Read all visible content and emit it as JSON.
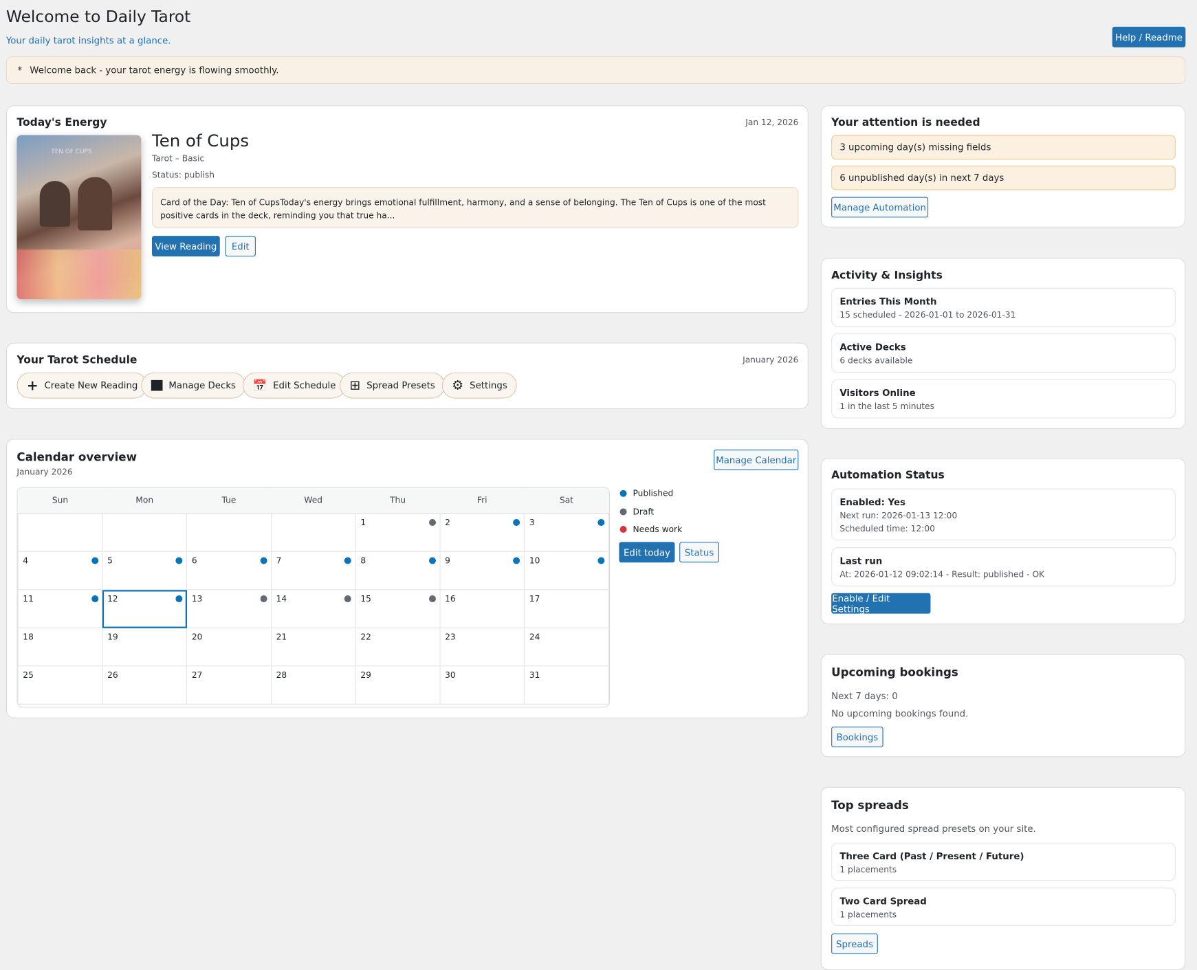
{
  "header": {
    "title": "Welcome to Daily Tarot",
    "subtitle": "Your daily tarot insights at a glance.",
    "help_label": "Help / Readme"
  },
  "notice": {
    "bullet": "*",
    "text": "Welcome back - your tarot energy is flowing smoothly."
  },
  "today": {
    "heading": "Today's Energy",
    "date": "Jan 12, 2026",
    "card_name": "Ten of Cups",
    "card_image_text": "TEN OF CUPS",
    "deck": "Tarot – Basic",
    "status": "Status: publish",
    "excerpt": "Card of the Day: Ten of CupsToday's energy brings emotional fulfillment, harmony, and a sense of belonging. The Ten of Cups is one of the most positive cards in the deck, reminding you that true ha...",
    "view_label": "View Reading",
    "edit_label": "Edit"
  },
  "schedule": {
    "heading": "Your Tarot Schedule",
    "month": "January 2026",
    "actions": [
      {
        "label": "Create New Reading",
        "icon": "plus-icon"
      },
      {
        "label": "Manage Decks",
        "icon": "box-icon"
      },
      {
        "label": "Edit Schedule",
        "icon": "calendar-icon"
      },
      {
        "label": "Spread Presets",
        "icon": "grid-icon"
      },
      {
        "label": "Settings",
        "icon": "gear-icon"
      }
    ]
  },
  "calendar": {
    "heading": "Calendar overview",
    "month": "January 2026",
    "manage_label": "Manage Calendar",
    "weekdays": [
      "Sun",
      "Mon",
      "Tue",
      "Wed",
      "Thu",
      "Fri",
      "Sat"
    ],
    "weeks": [
      [
        null,
        null,
        null,
        null,
        {
          "d": "1",
          "s": "draft"
        },
        {
          "d": "2",
          "s": "published"
        },
        {
          "d": "3",
          "s": "published"
        }
      ],
      [
        {
          "d": "4",
          "s": "published"
        },
        {
          "d": "5",
          "s": "published"
        },
        {
          "d": "6",
          "s": "published"
        },
        {
          "d": "7",
          "s": "published"
        },
        {
          "d": "8",
          "s": "published"
        },
        {
          "d": "9",
          "s": "published"
        },
        {
          "d": "10",
          "s": "published"
        }
      ],
      [
        {
          "d": "11",
          "s": "published"
        },
        {
          "d": "12",
          "s": "published",
          "today": true
        },
        {
          "d": "13",
          "s": "draft"
        },
        {
          "d": "14",
          "s": "draft"
        },
        {
          "d": "15",
          "s": "draft"
        },
        {
          "d": "16"
        },
        {
          "d": "17"
        }
      ],
      [
        {
          "d": "18"
        },
        {
          "d": "19"
        },
        {
          "d": "20"
        },
        {
          "d": "21"
        },
        {
          "d": "22"
        },
        {
          "d": "23"
        },
        {
          "d": "24"
        }
      ],
      [
        {
          "d": "25"
        },
        {
          "d": "26"
        },
        {
          "d": "27"
        },
        {
          "d": "28"
        },
        {
          "d": "29"
        },
        {
          "d": "30"
        },
        {
          "d": "31"
        }
      ]
    ],
    "legend": [
      {
        "label": "Published",
        "color": "#0a73b7"
      },
      {
        "label": "Draft",
        "color": "#646970"
      },
      {
        "label": "Needs work",
        "color": "#d63638"
      }
    ],
    "edit_today_label": "Edit today",
    "status_label": "Status"
  },
  "attention": {
    "heading": "Your attention is needed",
    "items": [
      "3 upcoming day(s) missing fields",
      "6 unpublished day(s) in next 7 days"
    ],
    "button": "Manage Automation"
  },
  "activity": {
    "heading": "Activity & Insights",
    "items": [
      {
        "title": "Entries This Month",
        "detail": "15 scheduled - 2026-01-01 to 2026-01-31"
      },
      {
        "title": "Active Decks",
        "detail": "6 decks available"
      },
      {
        "title": "Visitors Online",
        "detail": "1 in the last 5 minutes"
      }
    ]
  },
  "automation": {
    "heading": "Automation Status",
    "enabled": "Enabled: Yes",
    "next_run": "Next run: 2026-01-13 12:00",
    "scheduled": "Scheduled time: 12:00",
    "last_run_title": "Last run",
    "last_run": "At: 2026-01-12 09:02:14 - Result: published - OK",
    "button": "Enable / Edit Settings"
  },
  "bookings": {
    "heading": "Upcoming bookings",
    "next": "Next 7 days: 0",
    "empty": "No upcoming bookings found.",
    "button": "Bookings"
  },
  "spreads": {
    "heading": "Top spreads",
    "desc": "Most configured spread presets on your site.",
    "items": [
      {
        "title": "Three Card (Past / Present / Future)",
        "detail": "1 placements"
      },
      {
        "title": "Two Card Spread",
        "detail": "1 placements"
      }
    ],
    "button": "Spreads"
  }
}
